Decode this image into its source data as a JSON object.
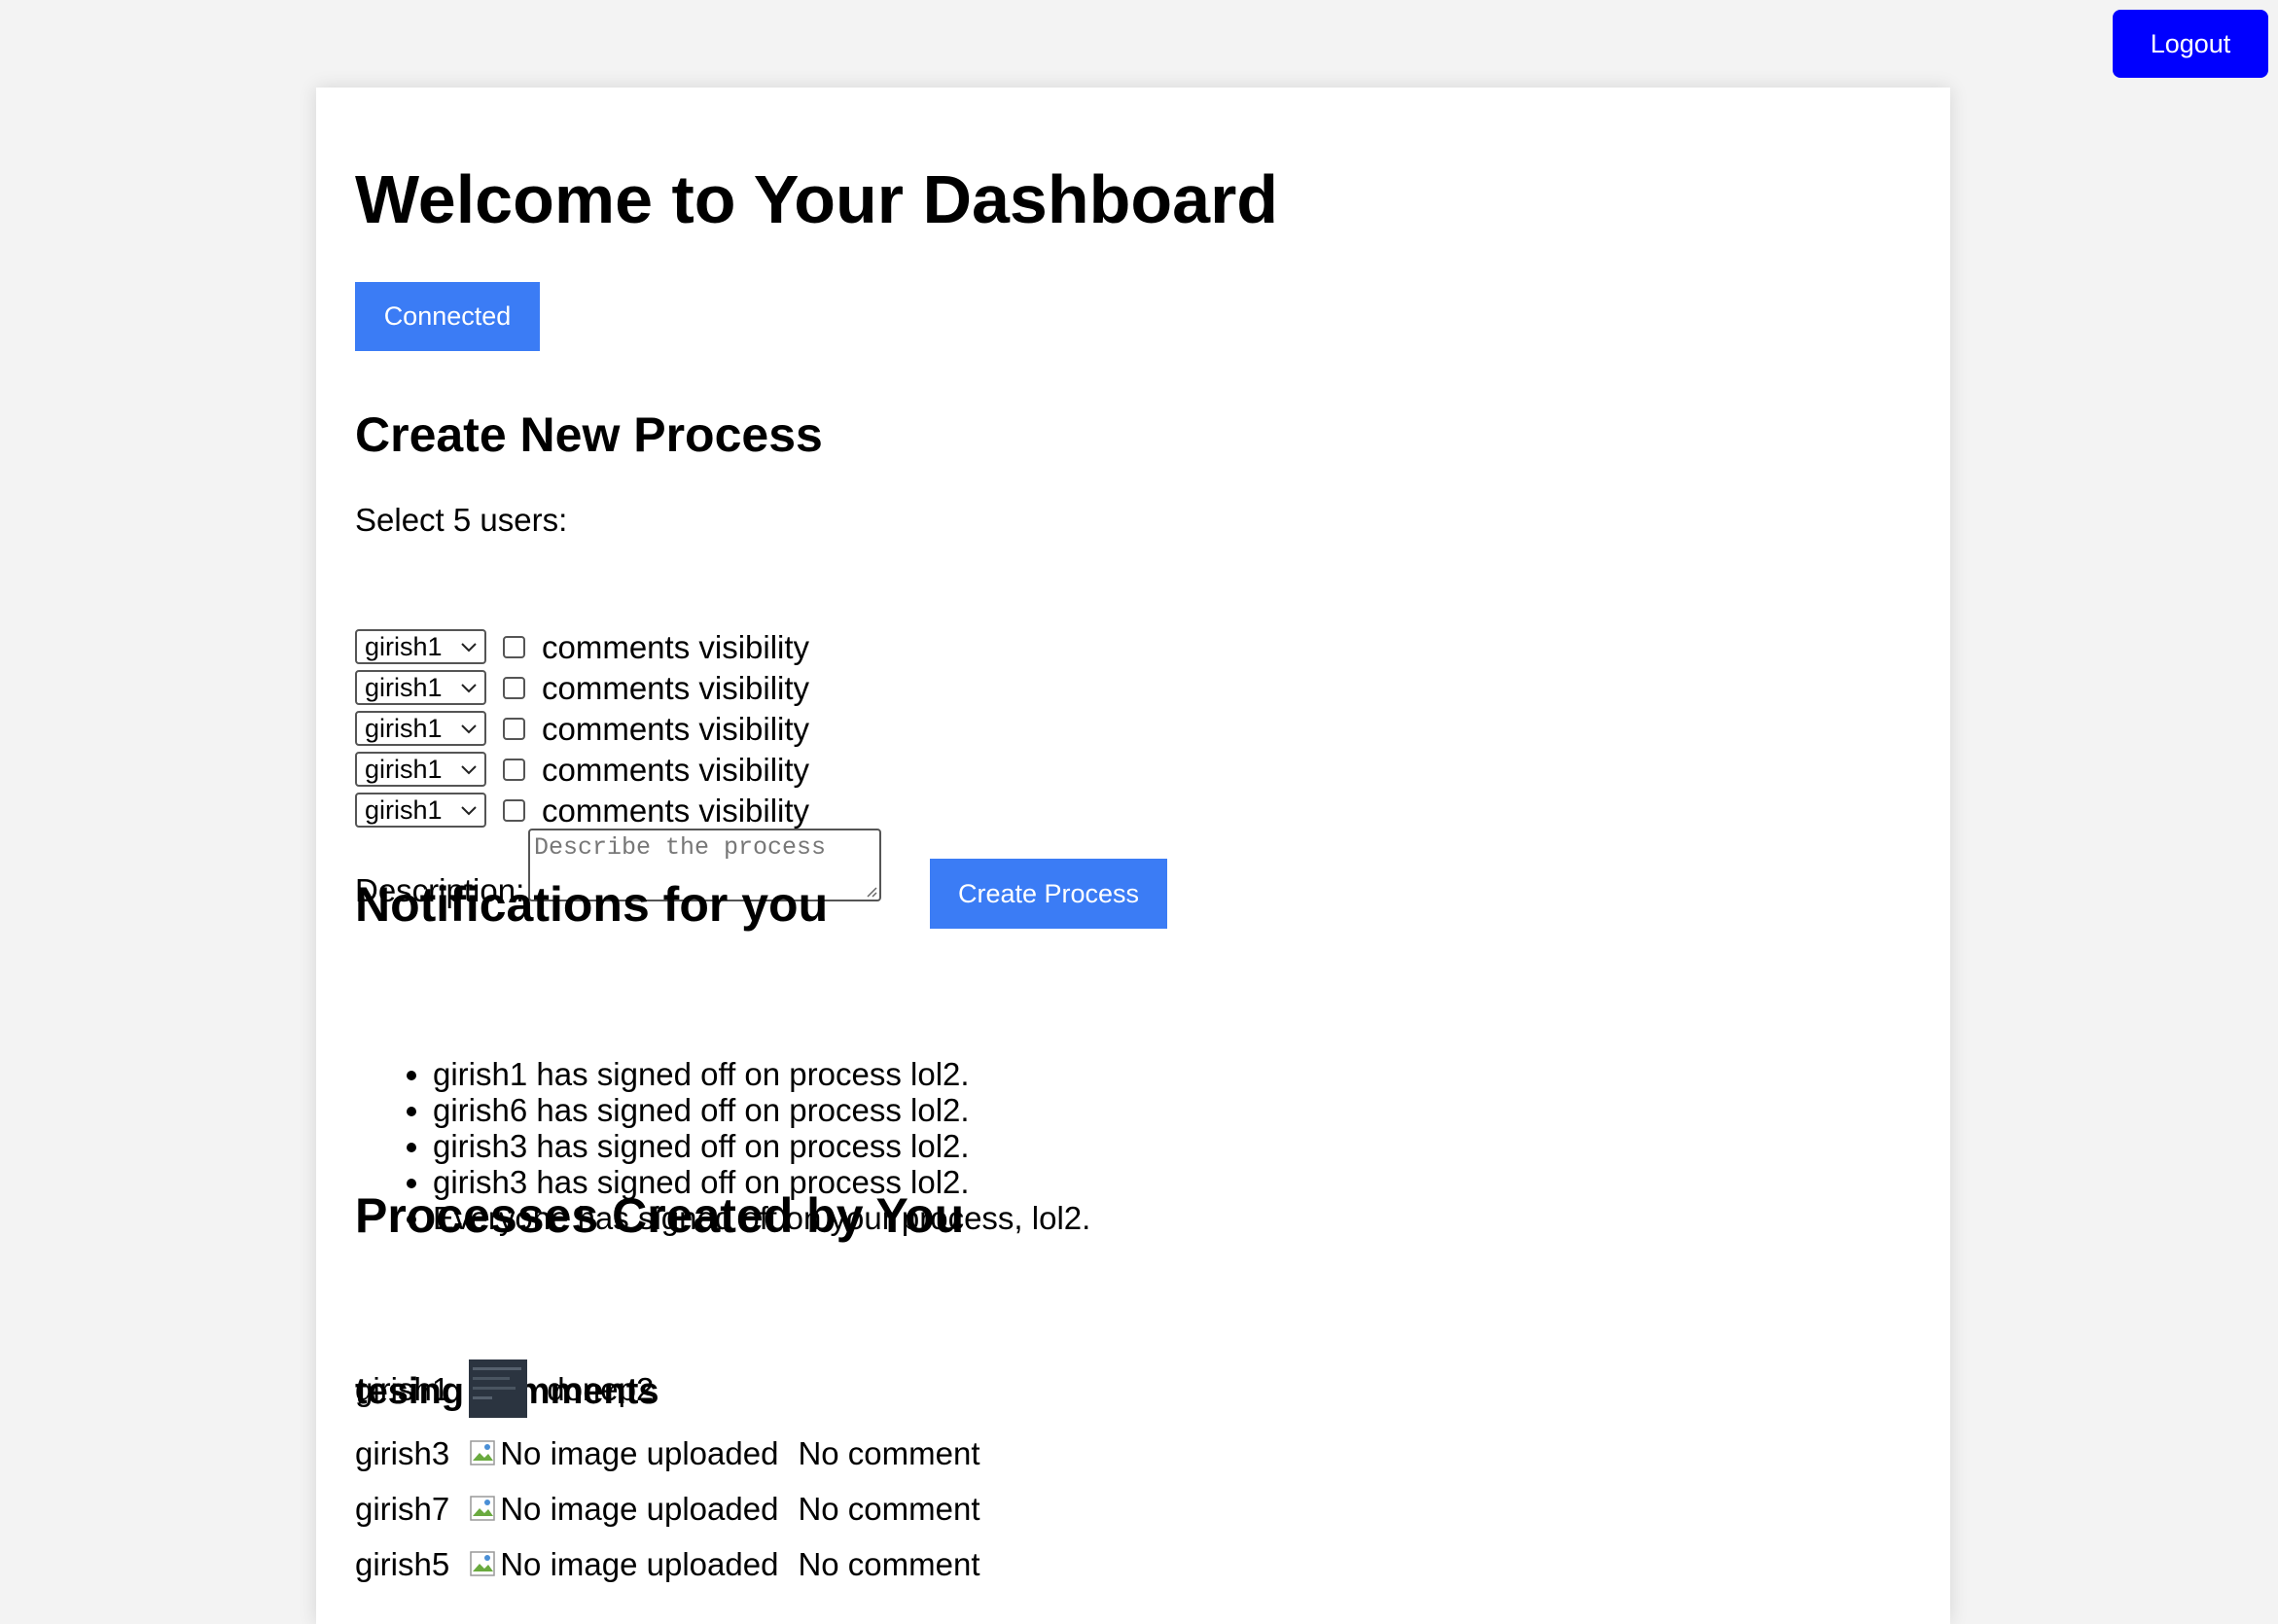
{
  "header": {
    "logout_label": "Logout",
    "logout_color": "#0000ff"
  },
  "dashboard": {
    "title": "Welcome to Your Dashboard",
    "status_label": "Connected",
    "accent_color": "#3b7cf5"
  },
  "create_process": {
    "heading": "Create New Process",
    "select_label": "Select 5 users:",
    "user_rows": [
      {
        "selected_user": "girish1",
        "checkbox_label": "comments visibility",
        "checked": false
      },
      {
        "selected_user": "girish1",
        "checkbox_label": "comments visibility",
        "checked": false
      },
      {
        "selected_user": "girish1",
        "checkbox_label": "comments visibility",
        "checked": false
      },
      {
        "selected_user": "girish1",
        "checkbox_label": "comments visibility",
        "checked": false
      },
      {
        "selected_user": "girish1",
        "checkbox_label": "comments visibility",
        "checked": false
      }
    ],
    "description_label": "Description:",
    "description_placeholder": "Describe the process",
    "description_value": "",
    "submit_label": "Create Process"
  },
  "notifications": {
    "heading": "Notifications for you",
    "items": [
      "girish1 has signed off on process lol2.",
      "girish6 has signed off on process lol2.",
      "girish3 has signed off on process lol2.",
      "girish3 has signed off on process lol2.",
      "Everyone has signed off on your process, lol2."
    ]
  },
  "processes": {
    "heading": "Processes Created by You",
    "list": [
      {
        "title": "tesing comments",
        "signoffs": [
          {
            "user": "girish1",
            "has_image": true,
            "image_alt": "",
            "comment": "donep2"
          },
          {
            "user": "girish3",
            "has_image": false,
            "image_alt": "No image uploaded",
            "comment": "No comment"
          },
          {
            "user": "girish7",
            "has_image": false,
            "image_alt": "No image uploaded",
            "comment": "No comment"
          },
          {
            "user": "girish5",
            "has_image": false,
            "image_alt": "No image uploaded",
            "comment": "No comment"
          }
        ]
      }
    ]
  }
}
